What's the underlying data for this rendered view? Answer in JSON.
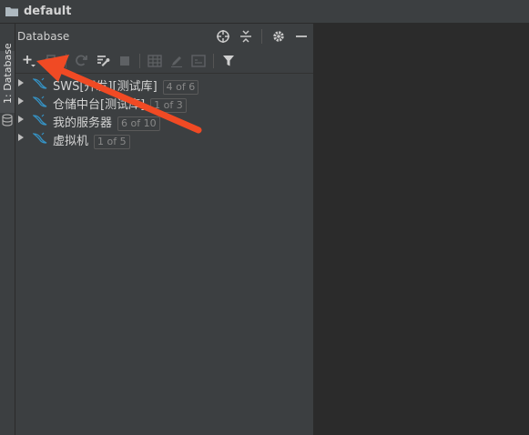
{
  "window": {
    "project_name": "default"
  },
  "side_stripe": {
    "tab_label": "1: Database"
  },
  "panel": {
    "title": "Database"
  },
  "tree": {
    "items": [
      {
        "name": "SWS[开发][测试库]",
        "badge": "4 of 6"
      },
      {
        "name": "仓储中台[测试库]",
        "badge": "1 of 3"
      },
      {
        "name": "我的服务器",
        "badge": "6 of 10"
      },
      {
        "name": "虚拟机",
        "badge": "1 of 5"
      }
    ]
  },
  "colors": {
    "accent_arrow": "#f04a24",
    "dolphin": "#3592c4",
    "panel_bg": "#3c3f41",
    "editor_bg": "#2b2b2b"
  }
}
